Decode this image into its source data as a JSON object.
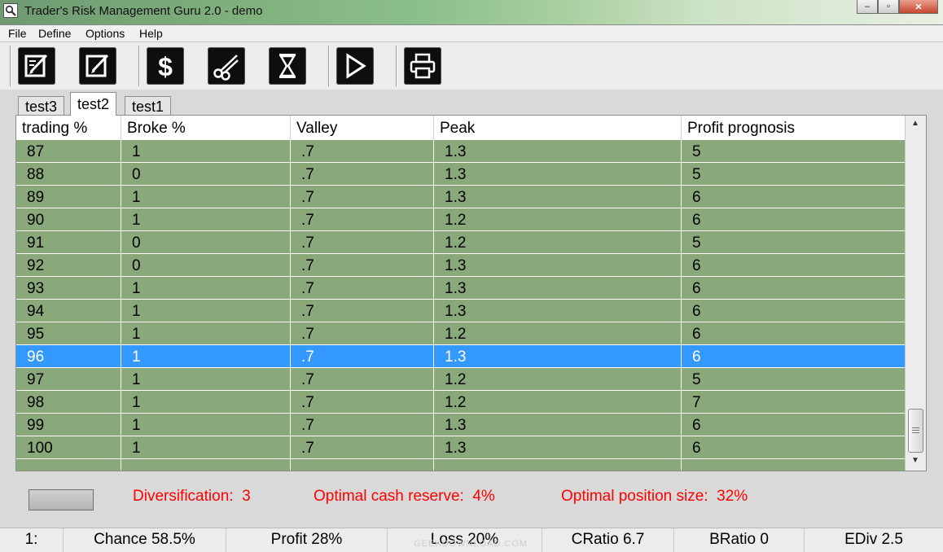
{
  "window": {
    "title": "Trader's Risk Management Guru 2.0 - demo",
    "minimize": "–",
    "maximize": "▫",
    "close": "✕"
  },
  "menu": [
    "File",
    "Define",
    "Options",
    "Help"
  ],
  "toolbar_icons": [
    "edit-icon",
    "edit-icon",
    "dollar-icon",
    "scissors-icon",
    "hourglass-icon",
    "play-icon",
    "printer-icon"
  ],
  "tabs": [
    {
      "label": "test3",
      "active": false
    },
    {
      "label": "test2",
      "active": true
    },
    {
      "label": "test1",
      "active": false
    }
  ],
  "table": {
    "headers": [
      "trading %",
      "Broke %",
      "Valley",
      "Peak",
      "Profit prognosis"
    ],
    "rows": [
      [
        "87",
        "1",
        ".7",
        "1.3",
        "5"
      ],
      [
        "88",
        "0",
        ".7",
        "1.3",
        "5"
      ],
      [
        "89",
        "1",
        ".7",
        "1.3",
        "6"
      ],
      [
        "90",
        "1",
        ".7",
        "1.2",
        "6"
      ],
      [
        "91",
        "0",
        ".7",
        "1.2",
        "5"
      ],
      [
        "92",
        "0",
        ".7",
        "1.3",
        "6"
      ],
      [
        "93",
        "1",
        ".7",
        "1.3",
        "6"
      ],
      [
        "94",
        "1",
        ".7",
        "1.3",
        "6"
      ],
      [
        "95",
        "1",
        ".7",
        "1.2",
        "6"
      ],
      [
        "96",
        "1",
        ".7",
        "1.3",
        "6"
      ],
      [
        "97",
        "1",
        ".7",
        "1.2",
        "5"
      ],
      [
        "98",
        "1",
        ".7",
        "1.2",
        "7"
      ],
      [
        "99",
        "1",
        ".7",
        "1.3",
        "6"
      ],
      [
        "100",
        "1",
        ".7",
        "1.3",
        "6"
      ]
    ],
    "selected_row": 9,
    "row_color": "#8aa97a",
    "selected_color": "#3399ff"
  },
  "stats": {
    "diversification": "Diversification:  3",
    "cash_reserve": "Optimal cash reserve:  4%",
    "position_size": "Optimal position size:  32%",
    "color": "#ff0000"
  },
  "status": [
    "1:",
    "Chance 58.5%",
    "Profit 28%",
    "Loss 20%",
    "CRatio 6.7",
    "BRatio 0",
    "EDiv 2.5"
  ],
  "watermark": "GEEKDOWNLOAD.COM"
}
